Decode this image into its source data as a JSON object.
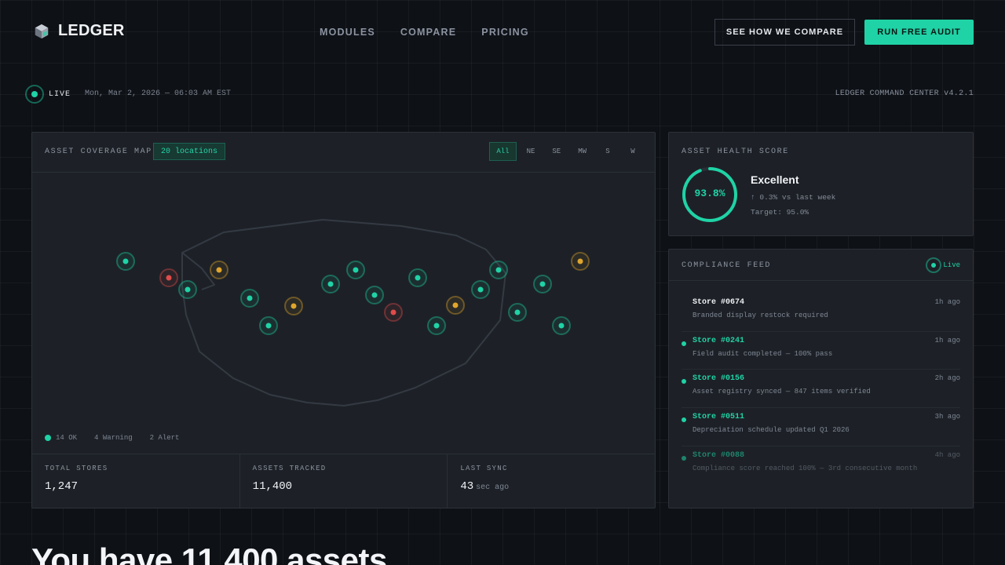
{
  "header": {
    "logo_text": "LEDGER",
    "logo_icon": "cube-icon",
    "nav": [
      "MODULES",
      "COMPARE",
      "PRICING"
    ],
    "cta_secondary": "SEE HOW WE COMPARE",
    "cta_primary": "RUN FREE AUDIT"
  },
  "status_bar": {
    "live_label": "LIVE",
    "timestamp": "Mon, Mar 2, 2026 — 06:03 AM EST",
    "version": "LEDGER COMMAND CENTER v4.2.1"
  },
  "map": {
    "title": "ASSET COVERAGE MAP",
    "locations_badge": "20 locations",
    "filters": [
      "All",
      "NE",
      "SE",
      "MW",
      "S",
      "W"
    ],
    "active_filter": "All",
    "status_colors": {
      "ok": "#1fd3a6",
      "warning": "#e0a52c",
      "alert": "#e04b4b"
    },
    "legend": {
      "ok": "14 OK",
      "warning": "4 Warning",
      "alert": "2 Alert"
    },
    "stats": [
      {
        "label": "TOTAL STORES",
        "value": "1,247",
        "unit": ""
      },
      {
        "label": "ASSETS TRACKED",
        "value": "11,400",
        "unit": ""
      },
      {
        "label": "LAST SYNC",
        "value": "43",
        "unit": "sec ago"
      }
    ]
  },
  "health": {
    "title": "ASSET HEALTH SCORE",
    "score_text": "93.8%",
    "score_fraction": 0.938,
    "rating": "Excellent",
    "delta": "↑ 0.3% vs last week",
    "target": "Target: 95.0%"
  },
  "feed": {
    "title": "COMPLIANCE FEED",
    "live_label": "Live",
    "items": [
      {
        "store": "Store #0674",
        "time": "1h ago",
        "message": "Branded display restock required",
        "status": "neutral"
      },
      {
        "store": "Store #0241",
        "time": "1h ago",
        "message": "Field audit completed — 100% pass",
        "status": "ok"
      },
      {
        "store": "Store #0156",
        "time": "2h ago",
        "message": "Asset registry synced — 847 items verified",
        "status": "ok"
      },
      {
        "store": "Store #0511",
        "time": "3h ago",
        "message": "Depreciation schedule updated Q1 2026",
        "status": "ok"
      },
      {
        "store": "Store #0088",
        "time": "4h ago",
        "message": "Compliance score reached 100% — 3rd consecutive month",
        "status": "ok"
      }
    ]
  },
  "hero": {
    "headline": "You have 11,400 assets"
  }
}
